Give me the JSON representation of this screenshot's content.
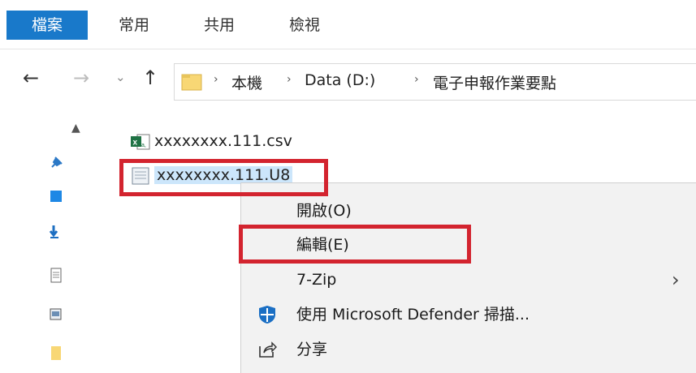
{
  "ribbon": {
    "tabs": [
      "檔案",
      "常用",
      "共用",
      "檢視"
    ]
  },
  "nav": {
    "back_icon": "←",
    "forward_icon": "→",
    "recent_icon": "⌄",
    "up_icon": "↑",
    "breadcrumbs": [
      "本機",
      "Data (D:)",
      "電子申報作業要點"
    ],
    "separator": "›"
  },
  "files": [
    {
      "name": "xxxxxxxx.111.csv",
      "icon": "excel-csv-icon"
    },
    {
      "name": "xxxxxxxx.111.U8",
      "icon": "text-file-icon",
      "selected": true
    }
  ],
  "context_menu": {
    "items": [
      {
        "label": "開啟(O)"
      },
      {
        "label": "編輯(E)"
      },
      {
        "label": "7-Zip",
        "submenu": true
      },
      {
        "label": "使用 Microsoft Defender 掃描...",
        "icon": "defender-shield-icon"
      },
      {
        "label": "分享",
        "icon": "share-icon"
      }
    ],
    "submenu_arrow": "›"
  },
  "colors": {
    "file_tab": "#1979ca",
    "highlight": "#d3242f",
    "selection": "#cce6fb",
    "menu_bg": "#f2f2f2"
  }
}
